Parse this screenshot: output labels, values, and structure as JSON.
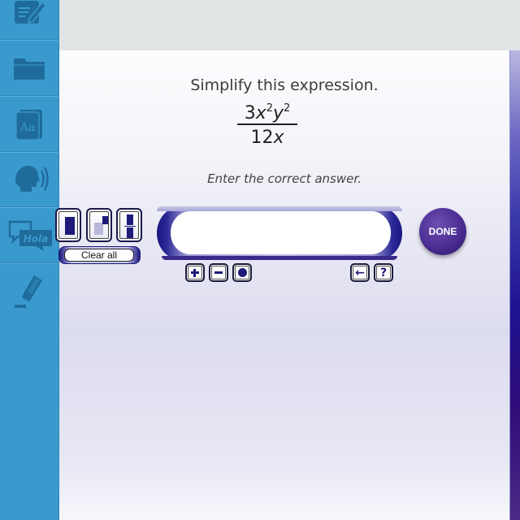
{
  "sidebar": {
    "items": [
      {
        "name": "notes",
        "icon": "notepad-pencil-icon"
      },
      {
        "name": "folder",
        "icon": "folder-icon"
      },
      {
        "name": "glossary",
        "icon": "dictionary-icon",
        "label": "Aa"
      },
      {
        "name": "read-aloud",
        "icon": "speaker-head-icon"
      },
      {
        "name": "translate",
        "icon": "translate-bubble-icon",
        "label": "Hola"
      },
      {
        "name": "highlighter",
        "icon": "highlighter-icon"
      }
    ]
  },
  "question": {
    "prompt": "Simplify this expression.",
    "numerator": {
      "coef": "3",
      "var1": "x",
      "exp1": "2",
      "var2": "y",
      "exp2": "2"
    },
    "denominator": {
      "coef": "12",
      "var": "x"
    },
    "instruction": "Enter the correct answer."
  },
  "answer": {
    "value": "",
    "placeholder": ""
  },
  "toolbar": {
    "template_keys": [
      "fraction-box",
      "exponent",
      "fraction"
    ],
    "clear_all_label": "Clear all",
    "plus_label": "+",
    "minus_label": "−",
    "dot_label": "•",
    "backspace_label": "←",
    "help_label": "?"
  },
  "done_label": "DONE",
  "colors": {
    "sidebar": "#3a9acd",
    "sidebar_icon": "#1f6c9c",
    "accent": "#1d1a7a",
    "done_button": "#4b2d94"
  }
}
